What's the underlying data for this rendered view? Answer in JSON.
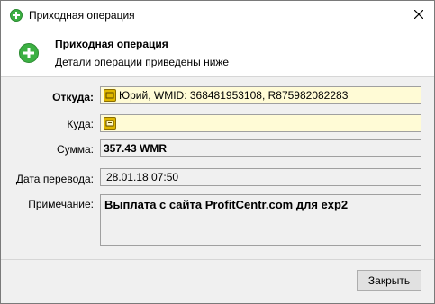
{
  "window": {
    "title": "Приходная операция"
  },
  "header": {
    "title": "Приходная операция",
    "subtitle": "Детали операции приведены ниже"
  },
  "form": {
    "from_label": "Откуда:",
    "from_value": "Юрий, WMID: 368481953108, R875982082283",
    "to_label": "Куда:",
    "to_value": "",
    "amount_label": "Сумма:",
    "amount_value": "357.43 WMR",
    "date_label": "Дата перевода:",
    "date_value": "28.01.18 07:50",
    "note_label": "Примечание:",
    "note_value": "Выплата с сайта ProfitCentr.com для exp2"
  },
  "footer": {
    "close_label": "Закрыть"
  },
  "icons": {
    "title": "plus-circle-icon",
    "header": "plus-circle-icon",
    "from": "wm-wallet-icon",
    "to": "wm-card-icon",
    "close": "close-icon"
  },
  "colors": {
    "accent_green": "#3cb043",
    "field_yellow": "#fffbd6",
    "window_bg": "#f0f0f0"
  }
}
